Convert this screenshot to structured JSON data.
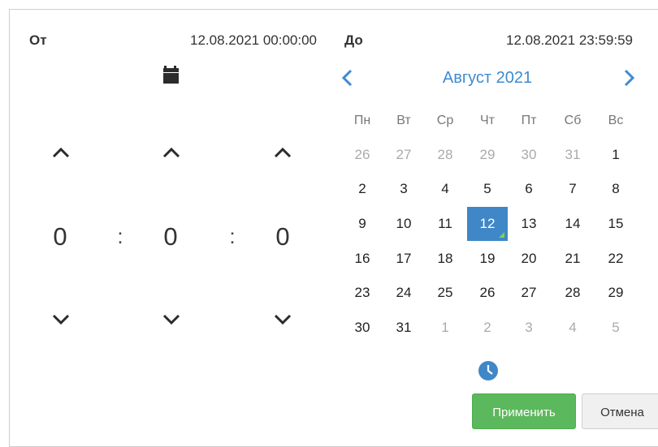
{
  "from": {
    "label": "От",
    "datetime": "12.08.2021 00:00:00"
  },
  "to": {
    "label": "До",
    "datetime": "12.08.2021 23:59:59"
  },
  "time": {
    "hours": "0",
    "minutes": "0",
    "seconds": "0",
    "separator": ":"
  },
  "calendar": {
    "month_title": "Август 2021",
    "weekdays": [
      "Пн",
      "Вт",
      "Ср",
      "Чт",
      "Пт",
      "Сб",
      "Вс"
    ],
    "weeks": [
      [
        {
          "d": "26",
          "other": true
        },
        {
          "d": "27",
          "other": true
        },
        {
          "d": "28",
          "other": true
        },
        {
          "d": "29",
          "other": true
        },
        {
          "d": "30",
          "other": true
        },
        {
          "d": "31",
          "other": true
        },
        {
          "d": "1"
        }
      ],
      [
        {
          "d": "2"
        },
        {
          "d": "3"
        },
        {
          "d": "4"
        },
        {
          "d": "5"
        },
        {
          "d": "6"
        },
        {
          "d": "7"
        },
        {
          "d": "8"
        }
      ],
      [
        {
          "d": "9"
        },
        {
          "d": "10"
        },
        {
          "d": "11"
        },
        {
          "d": "12",
          "selected": true
        },
        {
          "d": "13"
        },
        {
          "d": "14"
        },
        {
          "d": "15"
        }
      ],
      [
        {
          "d": "16"
        },
        {
          "d": "17"
        },
        {
          "d": "18"
        },
        {
          "d": "19"
        },
        {
          "d": "20"
        },
        {
          "d": "21"
        },
        {
          "d": "22"
        }
      ],
      [
        {
          "d": "23"
        },
        {
          "d": "24"
        },
        {
          "d": "25"
        },
        {
          "d": "26"
        },
        {
          "d": "27"
        },
        {
          "d": "28"
        },
        {
          "d": "29"
        }
      ],
      [
        {
          "d": "30"
        },
        {
          "d": "31"
        },
        {
          "d": "1",
          "other": true
        },
        {
          "d": "2",
          "other": true
        },
        {
          "d": "3",
          "other": true
        },
        {
          "d": "4",
          "other": true
        },
        {
          "d": "5",
          "other": true
        }
      ]
    ]
  },
  "buttons": {
    "apply": "Применить",
    "cancel": "Отмена"
  },
  "icons": {
    "calendar": "calendar-icon",
    "clock": "clock-icon",
    "prev": "chevron-left-icon",
    "next": "chevron-right-icon",
    "up": "chevron-up-icon",
    "down": "chevron-down-icon"
  },
  "colors": {
    "accent": "#3f87c7",
    "apply": "#5cb85c",
    "selected_marker": "#7fd14f"
  }
}
